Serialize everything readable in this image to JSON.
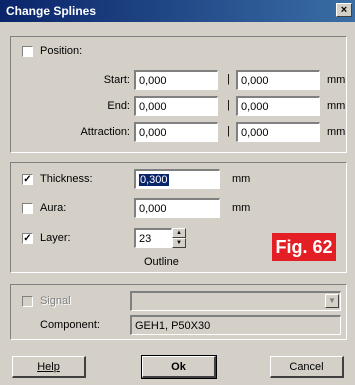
{
  "window": {
    "title": "Change Splines",
    "close_glyph": "×"
  },
  "position": {
    "label": "Position:",
    "checked": false,
    "rows": [
      {
        "label": "Start:",
        "v1": "0,000",
        "v2": "0,000",
        "unit": "mm"
      },
      {
        "label": "End:",
        "v1": "0,000",
        "v2": "0,000",
        "unit": "mm"
      },
      {
        "label": "Attraction:",
        "v1": "0,000",
        "v2": "0,000",
        "unit": "mm"
      }
    ],
    "separator": "|"
  },
  "props": {
    "thickness": {
      "label": "Thickness:",
      "checked": true,
      "value": "0,300",
      "unit": "mm"
    },
    "aura": {
      "label": "Aura:",
      "checked": false,
      "value": "0,000",
      "unit": "mm"
    },
    "layer": {
      "label": "Layer:",
      "checked": true,
      "value": "23",
      "name": "Outline"
    }
  },
  "figure_badge": "Fig. 62",
  "signal": {
    "label": "Signal",
    "checked": false,
    "value": ""
  },
  "component": {
    "label": "Component:",
    "value": "GEH1, P50X30"
  },
  "buttons": {
    "help": "Help",
    "ok": "Ok",
    "cancel": "Cancel"
  },
  "checkmark": "✓",
  "icons": {
    "close": "close-icon",
    "spin_up": "chevron-up-icon",
    "spin_down": "chevron-down-icon",
    "dropdown": "chevron-down-icon"
  },
  "colors": {
    "titlebar": "#0a246a",
    "badge": "#e31e24",
    "face": "#d4d0c8"
  }
}
